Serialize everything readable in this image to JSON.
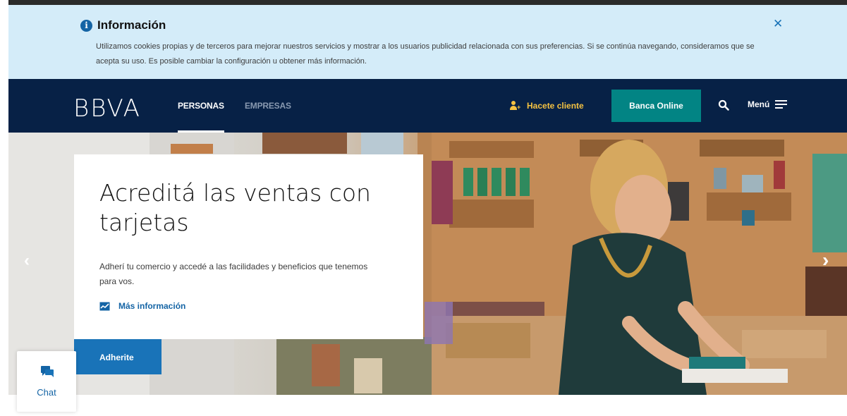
{
  "cookie_banner": {
    "title": "Información",
    "text": "Utilizamos cookies propias y de terceros para mejorar nuestros servicios y mostrar a los usuarios publicidad relacionada con sus preferencias. Si se continúa navegando, consideramos que se acepta su uso. Es posible cambiar la configuración u obtener más información.",
    "close_glyph": "✕",
    "info_icon": "info-icon"
  },
  "nav": {
    "logo": "BBVA",
    "personas": "PERSONAS",
    "empresas": "EMPRESAS",
    "hacete_cliente": "Hacete cliente",
    "banca_online": "Banca Online",
    "menu": "Menú"
  },
  "hero": {
    "title": "Acreditá las ventas con tarjetas",
    "description": "Adherí tu comercio y accedé a las facilidades y beneficios que tenemos para vos.",
    "more_info": "Más información",
    "cta": "Adherite",
    "prev_glyph": "‹",
    "next_glyph": "›"
  },
  "chat": {
    "label": "Chat"
  },
  "colors": {
    "navy": "#072146",
    "teal": "#028484",
    "blue": "#1973b8",
    "cookie_bg": "#d4ecf9",
    "yellow": "#f5c242"
  }
}
